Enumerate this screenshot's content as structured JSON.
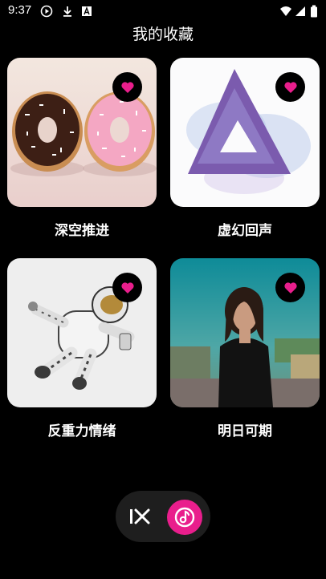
{
  "status": {
    "time": "9:37",
    "icons": [
      "play-circle-icon",
      "download-icon",
      "a-box-icon",
      "wifi-icon",
      "signal-icon",
      "battery-icon"
    ]
  },
  "title": "我的收藏",
  "accent_color": "#e91e8c",
  "favorites": [
    {
      "label": "深空推进",
      "art": "donuts-image",
      "liked": true
    },
    {
      "label": "虚幻回声",
      "art": "triangle-image",
      "liked": true
    },
    {
      "label": "反重力情绪",
      "art": "astronaut-image",
      "liked": true
    },
    {
      "label": "明日可期",
      "art": "portrait-image",
      "liked": true
    }
  ],
  "nav": {
    "items": [
      "close-icon",
      "music-icon"
    ]
  }
}
